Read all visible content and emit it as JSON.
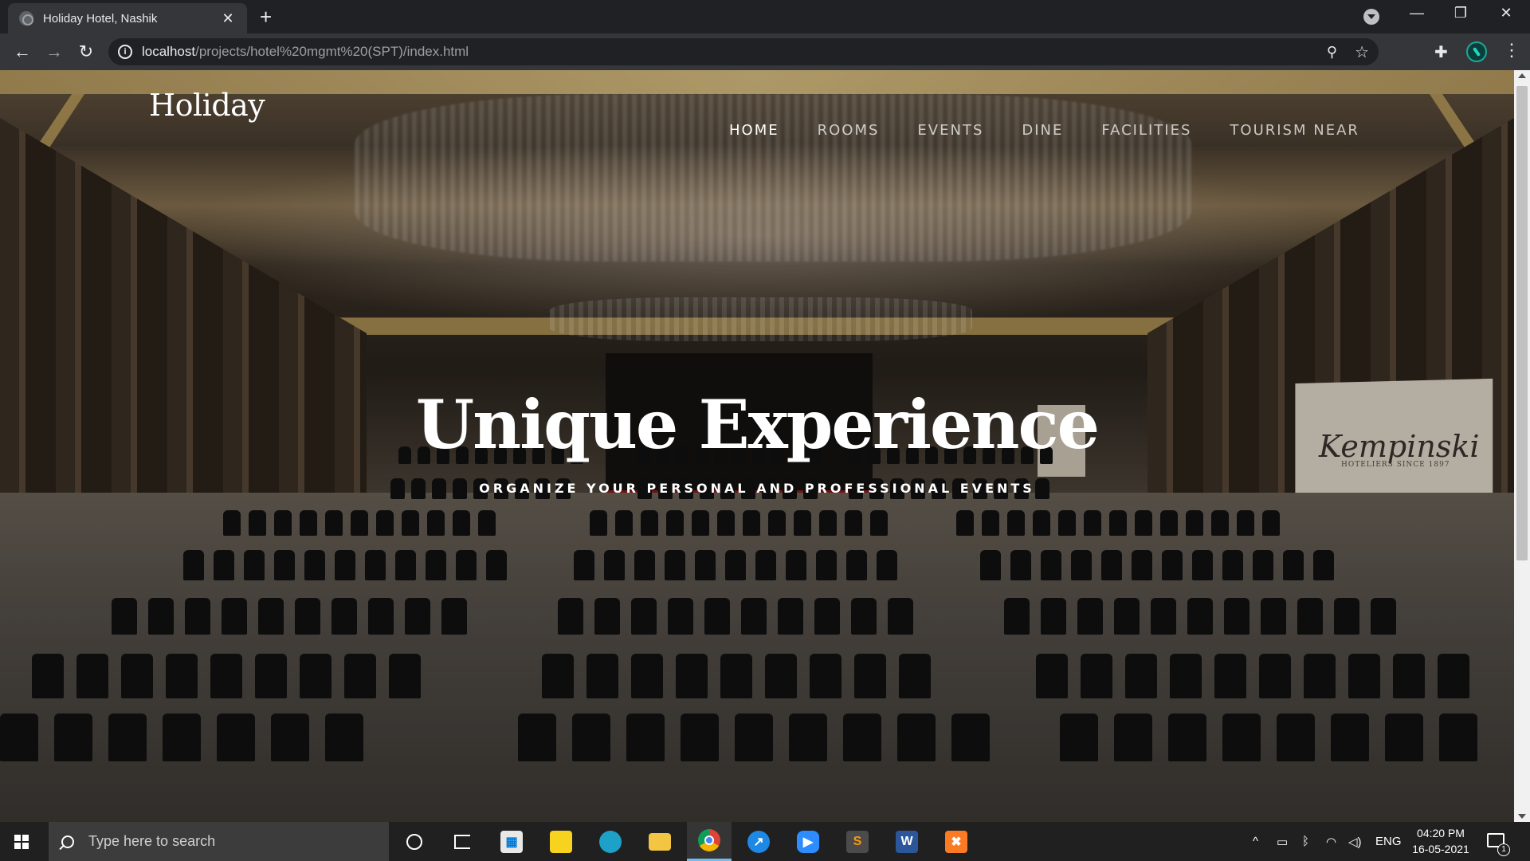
{
  "browser": {
    "tab_title": "Holiday Hotel, Nashik",
    "tab_close": "✕",
    "new_tab": "+",
    "url_host": "localhost",
    "url_path": "/projects/hotel%20mgmt%20(SPT)/index.html",
    "window": {
      "minimize": "—",
      "restore": "❐",
      "close": "✕"
    }
  },
  "site": {
    "logo": "Holiday",
    "nav": [
      "HOME",
      "ROOMS",
      "EVENTS",
      "DINE",
      "FACILITIES",
      "TOURISM NEAR"
    ],
    "active_nav": "HOME",
    "hero_title": "Unique Experience",
    "hero_subtitle": "ORGANIZE YOUR PERSONAL AND PROFESSIONAL EVENTS",
    "backdrop_signage": {
      "word": "Kempinski",
      "sub": "HOTELIERS SINCE 1897"
    }
  },
  "taskbar": {
    "search_placeholder": "Type here to search",
    "apps": [
      "cortana",
      "task-view",
      "store",
      "sticky-notes",
      "edge",
      "file-explorer",
      "chrome",
      "safari-like",
      "zoom",
      "sublime",
      "word",
      "xampp"
    ],
    "active_app": "chrome",
    "tray_language": "ENG",
    "time": "04:20 PM",
    "date": "16-05-2021",
    "notification_count": "1"
  },
  "colors": {
    "chrome_dark": "#202124",
    "chrome_toolbar": "#35363a",
    "taskbar": "#202020",
    "accent_gold": "#d4b264"
  }
}
